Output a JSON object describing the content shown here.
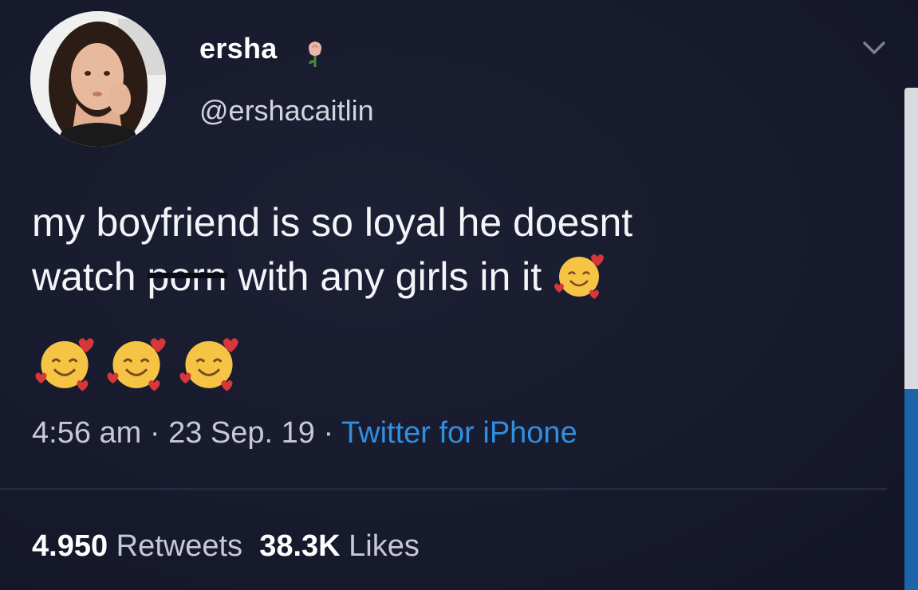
{
  "tweet": {
    "display_name": "ersha",
    "name_icon": "rose-icon",
    "handle": "@ershacaitlin",
    "text_line1": "my boyfriend is so loyal he doesnt",
    "text_line2_before": "watch ",
    "text_line2_censored": "porn",
    "text_line2_after": " with any girls in it ",
    "emoji": "smiling-face-with-hearts-icon",
    "time": "4:56 am",
    "sep1": " · ",
    "date": "23 Sep. 19",
    "sep2": " · ",
    "source": "Twitter for iPhone",
    "retweets_count": "4.950",
    "retweets_label": " Retweets",
    "likes_count": "38.3K",
    "likes_label": " Likes"
  },
  "colors": {
    "background": "#171a2e",
    "link": "#2f8fe0",
    "scroll_thumb": "#1b64a8"
  }
}
